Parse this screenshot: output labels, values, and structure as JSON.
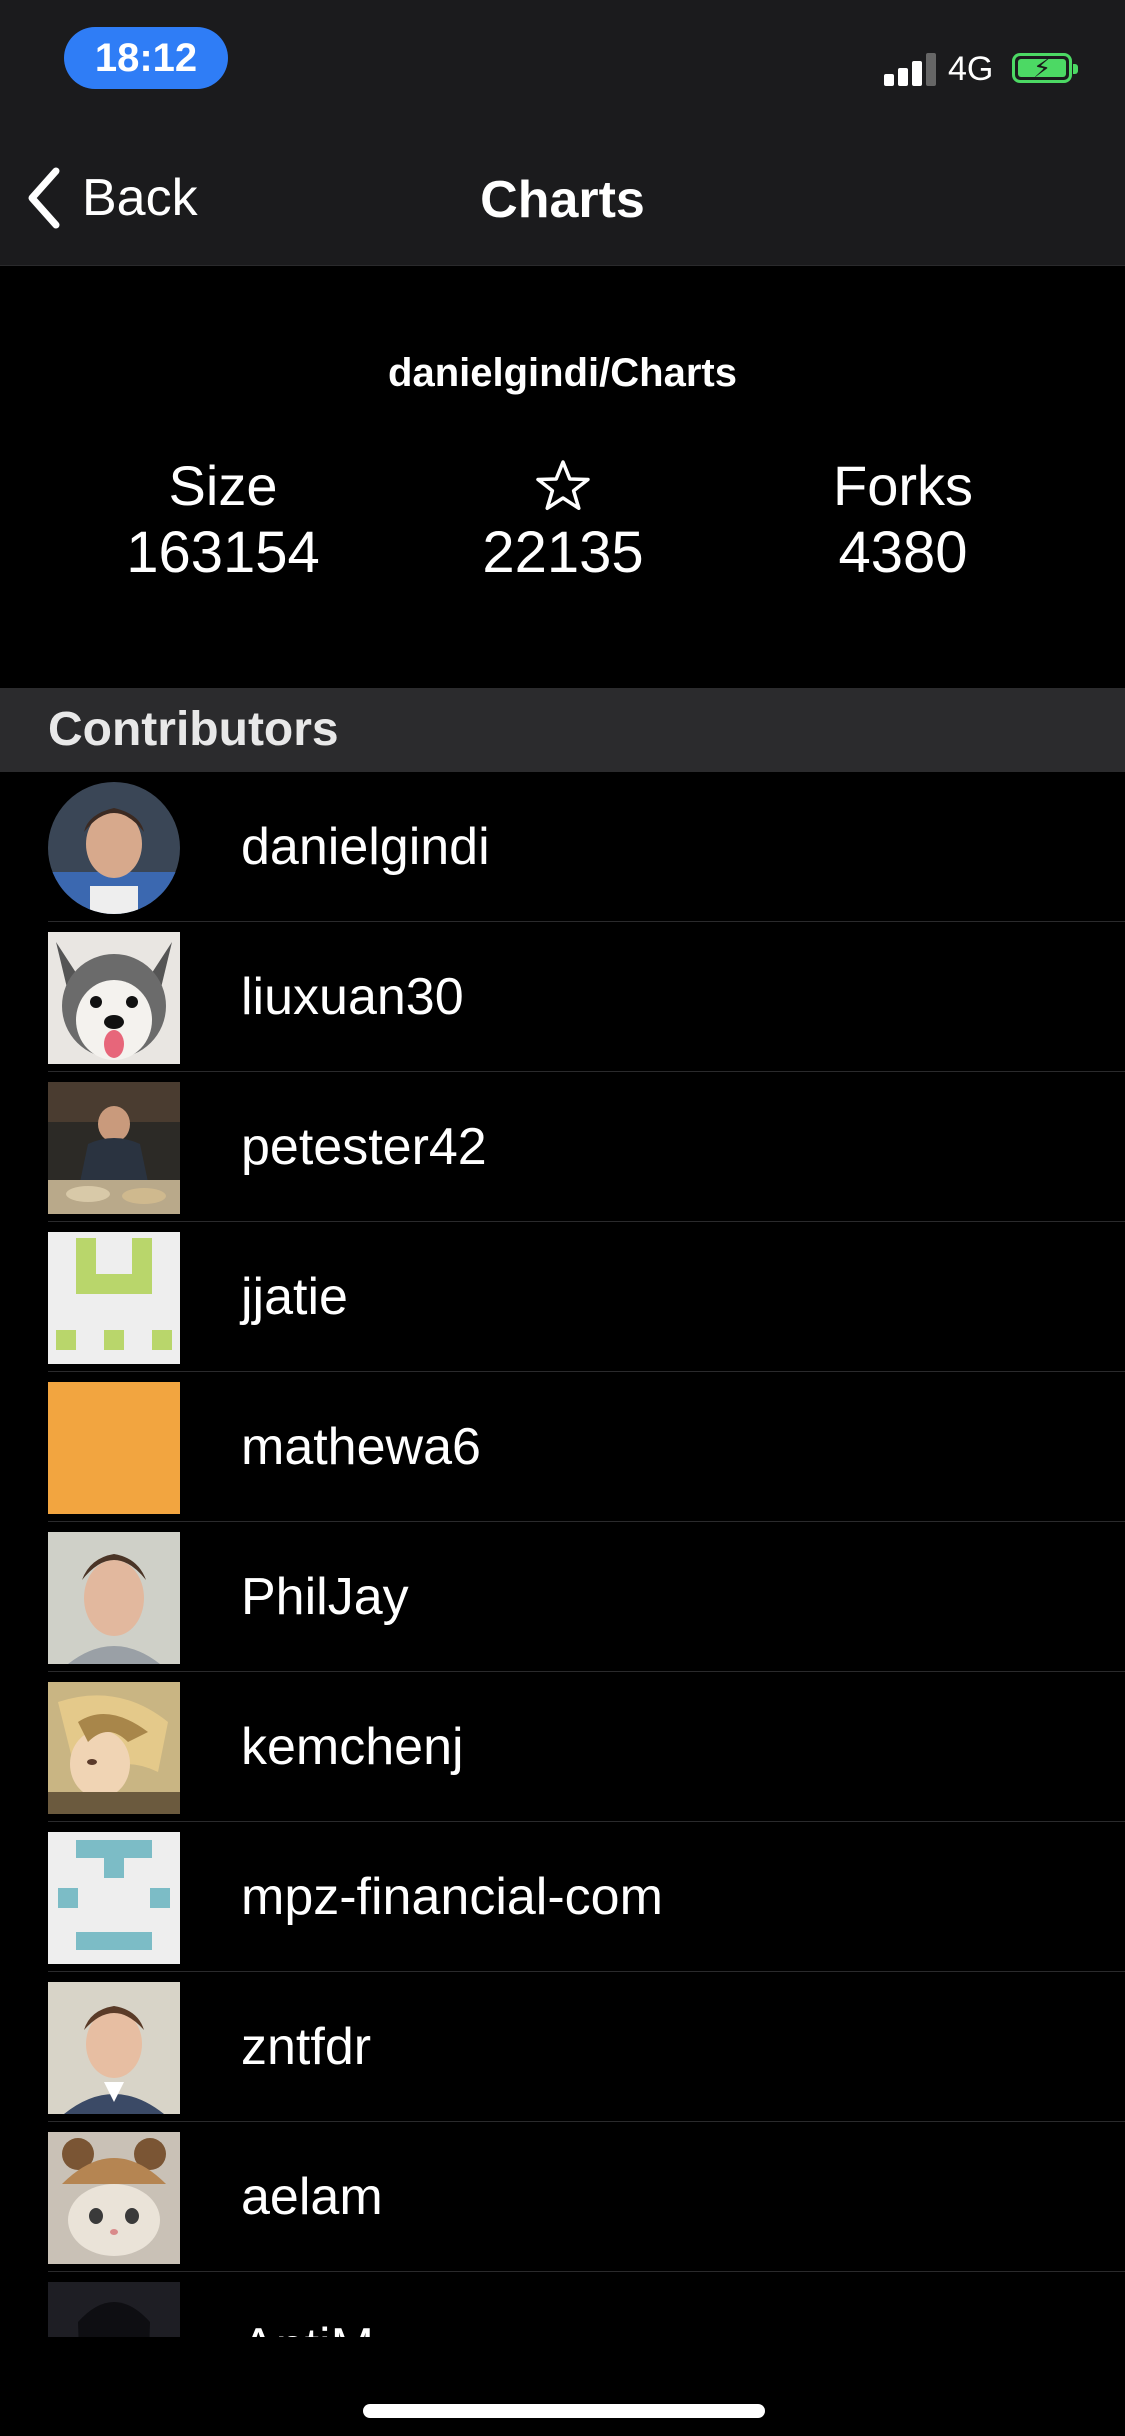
{
  "status_bar": {
    "time": "18:12",
    "network": "4G",
    "signal_bars_active": 3,
    "signal_bars_total": 4,
    "battery_charging": true
  },
  "nav": {
    "back_label": "Back",
    "title": "Charts"
  },
  "repo": {
    "full_name": "danielgindi/Charts",
    "stats": [
      {
        "label": "Size",
        "icon": null,
        "value": "163154"
      },
      {
        "label": null,
        "icon": "star-icon",
        "value": "22135"
      },
      {
        "label": "Forks",
        "icon": null,
        "value": "4380"
      }
    ]
  },
  "section": {
    "title": "Contributors"
  },
  "contributors": [
    {
      "login": "danielgindi",
      "avatar": "photo-portrait"
    },
    {
      "login": "liuxuan30",
      "avatar": "photo-husky-dog"
    },
    {
      "login": "petester42",
      "avatar": "photo-person-dining"
    },
    {
      "login": "jjatie",
      "avatar": "identicon-green"
    },
    {
      "login": "mathewa6",
      "avatar": "solid-orange"
    },
    {
      "login": "PhilJay",
      "avatar": "photo-portrait"
    },
    {
      "login": "kemchenj",
      "avatar": "illustration-anime"
    },
    {
      "login": "mpz-financial-com",
      "avatar": "identicon-teal"
    },
    {
      "login": "zntfdr",
      "avatar": "photo-portrait-suit"
    },
    {
      "login": "aelam",
      "avatar": "photo-cat-hat"
    },
    {
      "login": "AntiM",
      "avatar": "photo-dark"
    }
  ]
}
